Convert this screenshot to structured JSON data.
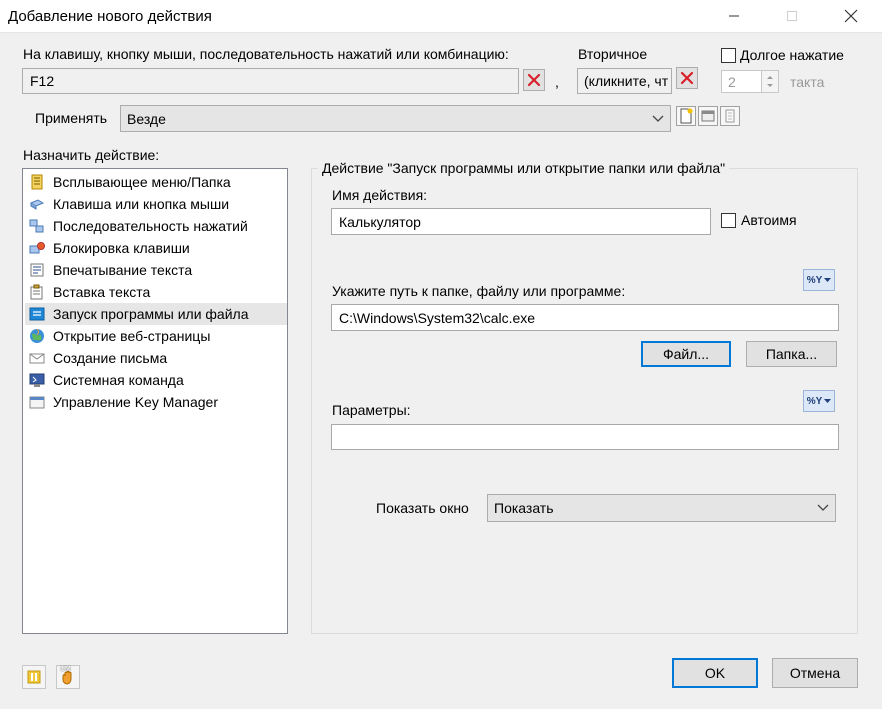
{
  "window": {
    "title": "Добавление нового действия",
    "minimize_icon": "minimize-icon",
    "maximize_icon": "maximize-icon",
    "close_icon": "close-icon"
  },
  "hotkey": {
    "label": "На клавишу, кнопку мыши, последовательность нажатий или комбинацию:",
    "value": "F12",
    "separator": ",",
    "secondary_label": "Вторичное",
    "secondary_value": "(кликните, чт",
    "long_press_label": "Долгое нажатие",
    "long_press_checked": false,
    "long_press_count": "2",
    "long_press_unit": "такта"
  },
  "apply": {
    "label": "Применять",
    "selected": "Везде"
  },
  "actions": {
    "label": "Назначить действие:",
    "items": [
      {
        "label": "Всплывающее меню/Папка",
        "icon": "popup-menu-icon",
        "selected": false
      },
      {
        "label": "Клавиша или кнопка мыши",
        "icon": "key-mouse-icon",
        "selected": false
      },
      {
        "label": "Последовательность нажатий",
        "icon": "key-sequence-icon",
        "selected": false
      },
      {
        "label": "Блокировка клавиши",
        "icon": "key-lock-icon",
        "selected": false
      },
      {
        "label": "Впечатывание текста",
        "icon": "type-text-icon",
        "selected": false
      },
      {
        "label": "Вставка текста",
        "icon": "paste-text-icon",
        "selected": false
      },
      {
        "label": "Запуск программы или файла",
        "icon": "run-program-icon",
        "selected": true
      },
      {
        "label": "Открытие веб-страницы",
        "icon": "web-page-icon",
        "selected": false
      },
      {
        "label": "Создание письма",
        "icon": "email-icon",
        "selected": false
      },
      {
        "label": "Системная команда",
        "icon": "system-command-icon",
        "selected": false
      },
      {
        "label": "Управление Key Manager",
        "icon": "key-manager-icon",
        "selected": false
      }
    ]
  },
  "panel": {
    "title": "Действие \"Запуск программы или открытие папки или файла\"",
    "name_label": "Имя действия:",
    "name_value": "Калькулятор",
    "autoname_label": "Автоимя",
    "autoname_checked": false,
    "path_label": "Укажите путь к папке, файлу или программе:",
    "path_value": "C:\\Windows\\System32\\calc.exe",
    "file_button": "Файл...",
    "folder_button": "Папка...",
    "variable_button": "%Y",
    "params_label": "Параметры:",
    "params_value": "",
    "show_window_label": "Показать окно",
    "show_window_value": "Показать"
  },
  "footer": {
    "ok": "OK",
    "cancel": "Отмена",
    "pause_icon": "pause-icon",
    "um_icon": "um-hand-icon",
    "um_text": "UM"
  },
  "colors": {
    "accent": "#0078d7",
    "delete_red": "#d9202a",
    "selection": "#e6e6e6"
  }
}
